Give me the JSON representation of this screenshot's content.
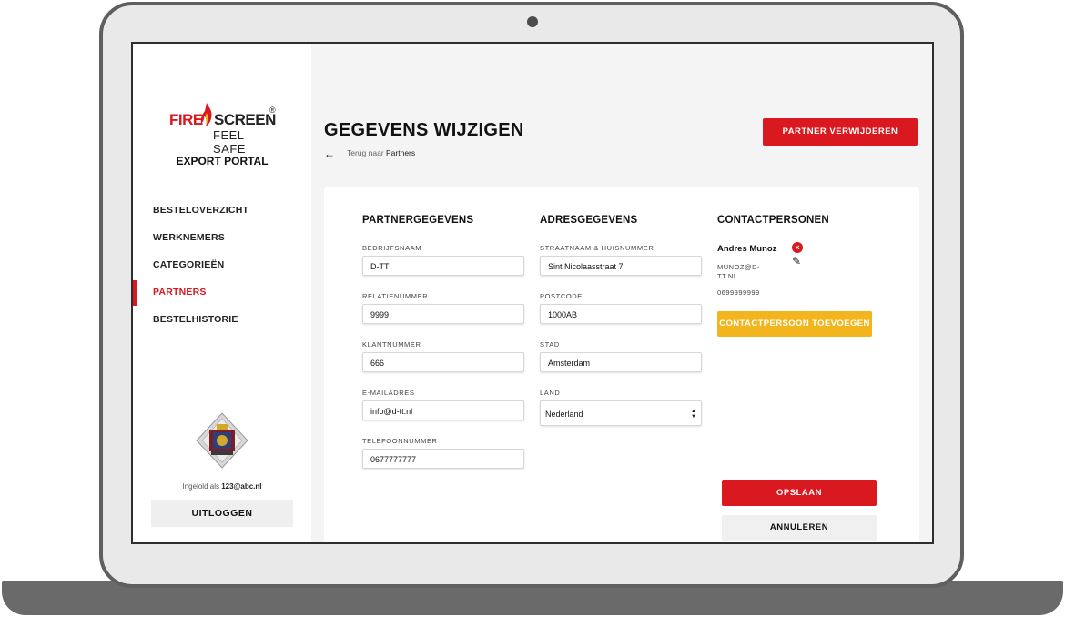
{
  "brand": {
    "logo_fire": "FIRE",
    "logo_screen": "SCREEN",
    "logo_reg": "®",
    "logo_tagline": "FEEL SAFE",
    "portal_title": "EXPORT PORTAL",
    "accent_red": "#d9181f",
    "accent_yellow": "#f2b51e"
  },
  "sidebar": {
    "items": [
      {
        "label": "BESTELOVERZICHT",
        "active": false
      },
      {
        "label": "WERKNEMERS",
        "active": false
      },
      {
        "label": "CATEGORIEËN",
        "active": false
      },
      {
        "label": "PARTNERS",
        "active": true
      },
      {
        "label": "BESTELHISTORIE",
        "active": false
      }
    ],
    "login_prefix": "Ingelold als",
    "login_user": "123@abc.nl",
    "logout_label": "UITLOGGEN"
  },
  "header": {
    "title": "GEGEVENS WIJZIGEN",
    "back_prefix": "Terug naar",
    "back_link": "Partners",
    "delete_label": "PARTNER VERWIJDEREN"
  },
  "partner": {
    "title": "PARTNERGEGEVENS",
    "fields": [
      {
        "label": "BEDRIJFSNAAM",
        "value": "D-TT"
      },
      {
        "label": "RELATIENUMMER",
        "value": "9999"
      },
      {
        "label": "KLANTNUMMER",
        "value": "666"
      },
      {
        "label": "E-MAILADRES",
        "value": "info@d-tt.nl"
      },
      {
        "label": "TELEFOONNUMMER",
        "value": "0677777777"
      }
    ]
  },
  "address": {
    "title": "ADRESGEGEVENS",
    "fields": [
      {
        "label": "STRAATNAAM & HUISNUMMER",
        "value": "Sint Nicolaasstraat 7"
      },
      {
        "label": "POSTCODE",
        "value": "1000AB"
      },
      {
        "label": "STAD",
        "value": "Amsterdam"
      },
      {
        "label": "LAND",
        "value": "Nederland"
      }
    ]
  },
  "contacts": {
    "title": "CONTACTPERSONEN",
    "items": [
      {
        "name": "Andres Munoz",
        "email": "MUNOZ@D-TT.NL",
        "phone": "0699999999"
      }
    ],
    "add_label": "CONTACTPERSOON TOEVOEGEN"
  },
  "actions": {
    "save_label": "OPSLAAN",
    "cancel_label": "ANNULEREN"
  }
}
